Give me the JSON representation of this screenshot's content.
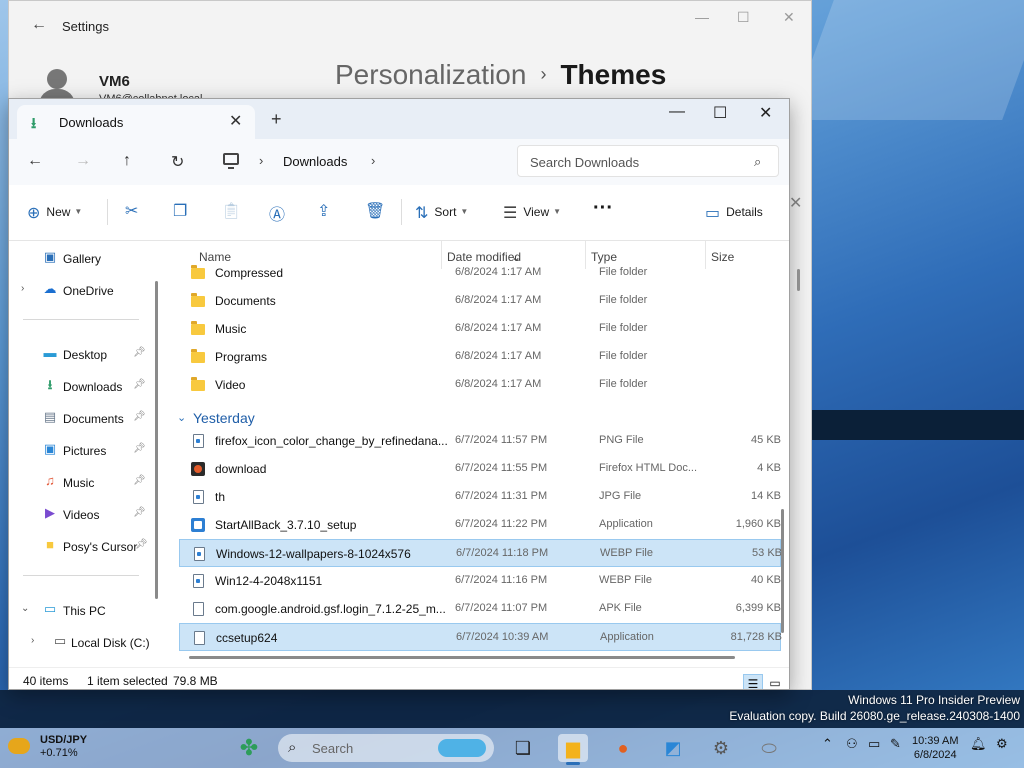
{
  "settings": {
    "title": "Settings",
    "user_name": "VM6",
    "user_email": "VM6@collabnet.local",
    "breadcrumb_parent": "Personalization",
    "breadcrumb_current": "Themes"
  },
  "explorer": {
    "tab_label": "Downloads",
    "path_location": "Downloads",
    "search_placeholder": "Search Downloads",
    "toolbar": {
      "new_label": "New",
      "sort_label": "Sort",
      "view_label": "View",
      "details_label": "Details"
    },
    "nav_items": [
      {
        "label": "Gallery",
        "icon": "gallery-icon",
        "pinned": false,
        "expandable": false
      },
      {
        "label": "OneDrive",
        "icon": "cloud-icon",
        "pinned": false,
        "expandable": true
      },
      {
        "label": "Desktop",
        "icon": "desktop-icon",
        "pinned": true,
        "expandable": false
      },
      {
        "label": "Downloads",
        "icon": "download-icon",
        "pinned": true,
        "expandable": false
      },
      {
        "label": "Documents",
        "icon": "documents-icon",
        "pinned": true,
        "expandable": false
      },
      {
        "label": "Pictures",
        "icon": "pictures-icon",
        "pinned": true,
        "expandable": false
      },
      {
        "label": "Music",
        "icon": "music-icon",
        "pinned": true,
        "expandable": false
      },
      {
        "label": "Videos",
        "icon": "videos-icon",
        "pinned": true,
        "expandable": false
      },
      {
        "label": "Posy's Cursor",
        "icon": "folder-icon",
        "pinned": true,
        "expandable": false
      },
      {
        "label": "This PC",
        "icon": "pc-icon",
        "pinned": false,
        "expandable": true
      },
      {
        "label": "Local Disk (C:)",
        "icon": "disk-icon",
        "pinned": false,
        "expandable": true
      }
    ],
    "columns": {
      "name": "Name",
      "date": "Date modified",
      "type": "Type",
      "size": "Size"
    },
    "group_yesterday": "Yesterday",
    "folders": [
      {
        "name": "Compressed",
        "date": "6/8/2024 1:17 AM",
        "type": "File folder",
        "size": ""
      },
      {
        "name": "Documents",
        "date": "6/8/2024 1:17 AM",
        "type": "File folder",
        "size": ""
      },
      {
        "name": "Music",
        "date": "6/8/2024 1:17 AM",
        "type": "File folder",
        "size": ""
      },
      {
        "name": "Programs",
        "date": "6/8/2024 1:17 AM",
        "type": "File folder",
        "size": ""
      },
      {
        "name": "Video",
        "date": "6/8/2024 1:17 AM",
        "type": "File folder",
        "size": ""
      }
    ],
    "files": [
      {
        "name": "firefox_icon_color_change_by_refinedana...",
        "date": "6/7/2024 11:57 PM",
        "type": "PNG File",
        "size": "45 KB",
        "icon": "image",
        "selected": false
      },
      {
        "name": "download",
        "date": "6/7/2024 11:55 PM",
        "type": "Firefox HTML Doc...",
        "size": "4 KB",
        "icon": "html",
        "selected": false
      },
      {
        "name": "th",
        "date": "6/7/2024 11:31 PM",
        "type": "JPG File",
        "size": "14 KB",
        "icon": "image",
        "selected": false
      },
      {
        "name": "StartAllBack_3.7.10_setup",
        "date": "6/7/2024 11:22 PM",
        "type": "Application",
        "size": "1,960 KB",
        "icon": "exe",
        "selected": false
      },
      {
        "name": "Windows-12-wallpapers-8-1024x576",
        "date": "6/7/2024 11:18 PM",
        "type": "WEBP File",
        "size": "53 KB",
        "icon": "image",
        "selected": true
      },
      {
        "name": "Win12-4-2048x1151",
        "date": "6/7/2024 11:16 PM",
        "type": "WEBP File",
        "size": "40 KB",
        "icon": "image",
        "selected": false
      },
      {
        "name": "com.google.android.gsf.login_7.1.2-25_m...",
        "date": "6/7/2024 11:07 PM",
        "type": "APK File",
        "size": "6,399 KB",
        "icon": "file",
        "selected": false
      },
      {
        "name": "ccsetup624",
        "date": "6/7/2024 10:39 AM",
        "type": "Application",
        "size": "81,728 KB",
        "icon": "file",
        "selected": true
      }
    ],
    "status": {
      "items_count": "40 items",
      "selection": "1 item selected",
      "selection_size": "79.8 MB"
    }
  },
  "watermark": {
    "line1": "Windows 11 Pro Insider Preview",
    "line2": "Evaluation copy. Build 26080.ge_release.240308-1400"
  },
  "taskbar": {
    "widget_title": "USD/JPY",
    "widget_value": "+0.71%",
    "search_placeholder": "Search",
    "time": "10:39 AM",
    "date": "6/8/2024"
  },
  "colors": {
    "accent": "#2a6fb8",
    "selection": "#cce4f7",
    "folder": "#f8c93e"
  }
}
